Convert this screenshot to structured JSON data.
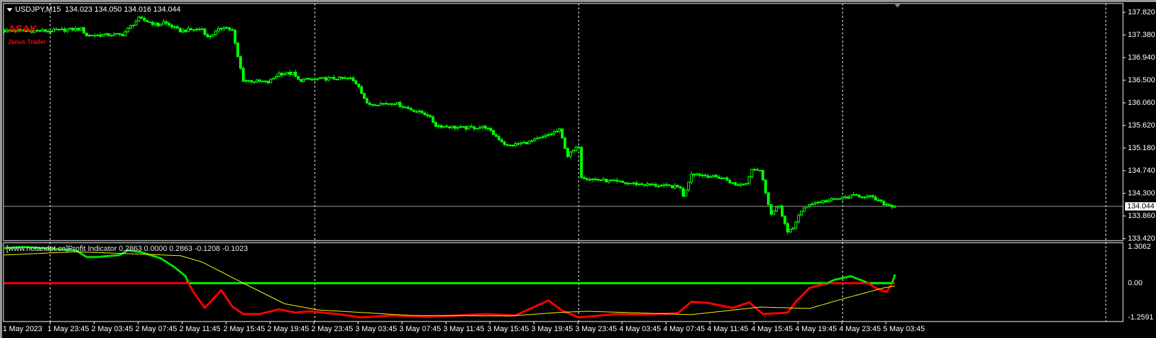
{
  "header": {
    "symbol_label": "USDJPY,M15",
    "ohlc": "134.023 134.050 134.016 134.044"
  },
  "overlay": {
    "logo": "ASAK",
    "subtitle": "Janus Trader"
  },
  "indicator": {
    "label": "[www.notandot.cn]Profit Indicator 0.2863 0.0000 0.2863 -0.1208 -0.1023"
  },
  "price_axis": {
    "labels": [
      "137.820",
      "137.380",
      "136.940",
      "136.500",
      "136.060",
      "135.620",
      "135.180",
      "134.740",
      "134.300",
      "133.860",
      "133.420"
    ],
    "current_price": "134.044"
  },
  "indicator_axis": {
    "labels": [
      "1.3062",
      "0.00",
      "-1.2591"
    ]
  },
  "time_axis": {
    "labels": [
      "1 May 2023",
      "1 May 23:45",
      "2 May 03:45",
      "2 May 07:45",
      "2 May 11:45",
      "2 May 15:45",
      "2 May 19:45",
      "2 May 23:45",
      "3 May 03:45",
      "3 May 07:45",
      "3 May 11:45",
      "3 May 15:45",
      "3 May 19:45",
      "3 May 23:45",
      "4 May 03:45",
      "4 May 07:45",
      "4 May 11:45",
      "4 May 15:45",
      "4 May 19:45",
      "4 May 23:45",
      "5 May 03:45"
    ]
  },
  "colors": {
    "bull": "#00ff00",
    "bear": "#00ff00",
    "main_pos": "#00e000",
    "main_neg": "#ff0000",
    "signal": "#ffff00",
    "grid": "#ffffff",
    "current_line": "#a0a0a8"
  },
  "chart_data": {
    "type": "candlestick",
    "symbol": "USDJPY",
    "timeframe": "M15",
    "ylim": [
      133.42,
      137.82
    ],
    "bar_count": 325,
    "close_path": [
      [
        0,
        137.46
      ],
      [
        17,
        137.46
      ],
      [
        28,
        137.5
      ],
      [
        30,
        137.37
      ],
      [
        43,
        137.39
      ],
      [
        49,
        137.7
      ],
      [
        56,
        137.57
      ],
      [
        58,
        137.63
      ],
      [
        64,
        137.46
      ],
      [
        72,
        137.5
      ],
      [
        74,
        137.33
      ],
      [
        80,
        137.55
      ],
      [
        83,
        137.46
      ],
      [
        85,
        136.95
      ],
      [
        87,
        136.5
      ],
      [
        96,
        136.46
      ],
      [
        100,
        136.63
      ],
      [
        105,
        136.63
      ],
      [
        107,
        136.5
      ],
      [
        117,
        136.53
      ],
      [
        126,
        136.53
      ],
      [
        129,
        136.39
      ],
      [
        132,
        136.03
      ],
      [
        142,
        136.06
      ],
      [
        148,
        135.93
      ],
      [
        154,
        135.83
      ],
      [
        157,
        135.62
      ],
      [
        167,
        135.57
      ],
      [
        175,
        135.59
      ],
      [
        183,
        135.22
      ],
      [
        191,
        135.3
      ],
      [
        196,
        135.39
      ],
      [
        202,
        135.53
      ],
      [
        205,
        135.03
      ],
      [
        209,
        135.22
      ],
      [
        210,
        134.63
      ],
      [
        212,
        134.59
      ],
      [
        226,
        134.5
      ],
      [
        246,
        134.42
      ],
      [
        247,
        134.23
      ],
      [
        250,
        134.69
      ],
      [
        262,
        134.59
      ],
      [
        266,
        134.46
      ],
      [
        270,
        134.5
      ],
      [
        272,
        134.79
      ],
      [
        275,
        134.75
      ],
      [
        277,
        134.33
      ],
      [
        279,
        133.89
      ],
      [
        282,
        134.06
      ],
      [
        285,
        133.53
      ],
      [
        287,
        133.62
      ],
      [
        289,
        133.89
      ],
      [
        293,
        134.1
      ],
      [
        303,
        134.19
      ],
      [
        310,
        134.26
      ],
      [
        315,
        134.23
      ],
      [
        320,
        134.1
      ],
      [
        324,
        134.044
      ]
    ],
    "indicator": {
      "name": "Profit Indicator",
      "ylim": [
        -1.2591,
        1.3062
      ],
      "main": [
        [
          0,
          1.26
        ],
        [
          7,
          1.3
        ],
        [
          26,
          1.18
        ],
        [
          30,
          0.94
        ],
        [
          34,
          0.94
        ],
        [
          42,
          1.01
        ],
        [
          45,
          1.18
        ],
        [
          50,
          1.11
        ],
        [
          57,
          0.89
        ],
        [
          62,
          0.57
        ],
        [
          66,
          0.25
        ],
        [
          67,
          0.0
        ],
        [
          69,
          -0.34
        ],
        [
          73,
          -0.89
        ],
        [
          79,
          -0.25
        ],
        [
          83,
          -0.84
        ],
        [
          87,
          -1.11
        ],
        [
          93,
          -1.11
        ],
        [
          100,
          -0.94
        ],
        [
          106,
          -1.06
        ],
        [
          111,
          -1.01
        ],
        [
          121,
          -1.11
        ],
        [
          130,
          -1.23
        ],
        [
          141,
          -1.16
        ],
        [
          154,
          -1.21
        ],
        [
          175,
          -1.11
        ],
        [
          186,
          -1.16
        ],
        [
          198,
          -0.62
        ],
        [
          203,
          -0.99
        ],
        [
          209,
          -1.23
        ],
        [
          223,
          -1.11
        ],
        [
          232,
          -1.13
        ],
        [
          245,
          -1.08
        ],
        [
          250,
          -0.67
        ],
        [
          256,
          -0.71
        ],
        [
          265,
          -0.89
        ],
        [
          271,
          -0.69
        ],
        [
          276,
          -1.11
        ],
        [
          285,
          -1.06
        ],
        [
          288,
          -0.67
        ],
        [
          293,
          -0.17
        ],
        [
          299,
          -0.02
        ],
        [
          302,
          0.12
        ],
        [
          308,
          0.25
        ],
        [
          314,
          0.02
        ],
        [
          317,
          -0.17
        ],
        [
          321,
          -0.32
        ],
        [
          323,
          0.0
        ],
        [
          324,
          0.2863
        ]
      ],
      "signal": [
        [
          0,
          1.01
        ],
        [
          26,
          1.13
        ],
        [
          64,
          0.99
        ],
        [
          72,
          0.76
        ],
        [
          87,
          0.0
        ],
        [
          102,
          -0.74
        ],
        [
          114,
          -0.96
        ],
        [
          148,
          -1.16
        ],
        [
          184,
          -1.18
        ],
        [
          202,
          -1.05
        ],
        [
          212,
          -1.01
        ],
        [
          250,
          -1.13
        ],
        [
          275,
          -0.86
        ],
        [
          293,
          -0.91
        ],
        [
          306,
          -0.54
        ],
        [
          320,
          -0.17
        ],
        [
          324,
          -0.1023
        ]
      ]
    }
  }
}
